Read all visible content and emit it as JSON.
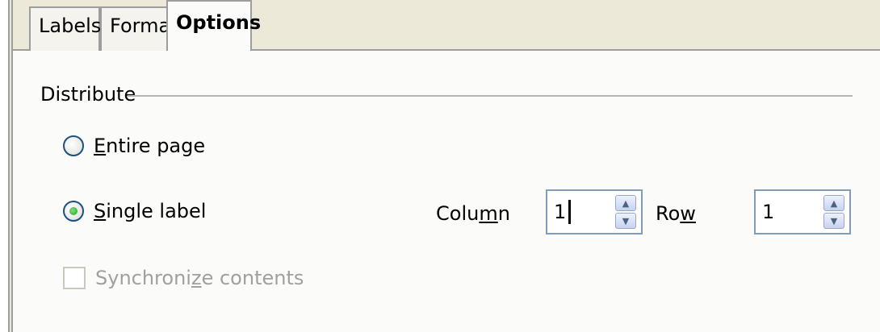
{
  "tabs": [
    {
      "label": "Labels",
      "active": false
    },
    {
      "label": "Format",
      "active": false
    },
    {
      "label": "Options",
      "active": true
    }
  ],
  "distribute": {
    "group_label": "Distribute",
    "entire_page": {
      "prefix": "",
      "mnemonic": "E",
      "rest": "ntire page",
      "selected": false
    },
    "single_label": {
      "prefix": "",
      "mnemonic": "S",
      "rest": "ingle label",
      "selected": true
    },
    "synchronize": {
      "prefix": "Synchroni",
      "mnemonic": "z",
      "rest": "e contents",
      "checked": false,
      "enabled": false
    }
  },
  "column": {
    "prefix": "Colu",
    "mnemonic": "m",
    "rest": "n",
    "value": "1"
  },
  "row": {
    "prefix": "Ro",
    "mnemonic": "w",
    "rest": "",
    "value": "1"
  },
  "icons": {
    "spin_up": "▲",
    "spin_down": "▼"
  },
  "colors": {
    "accent": "#1c5180",
    "radio_selected": "#1ea41e",
    "disabled_text": "#a0a0a0",
    "tab_bg": "#ece9d8"
  }
}
